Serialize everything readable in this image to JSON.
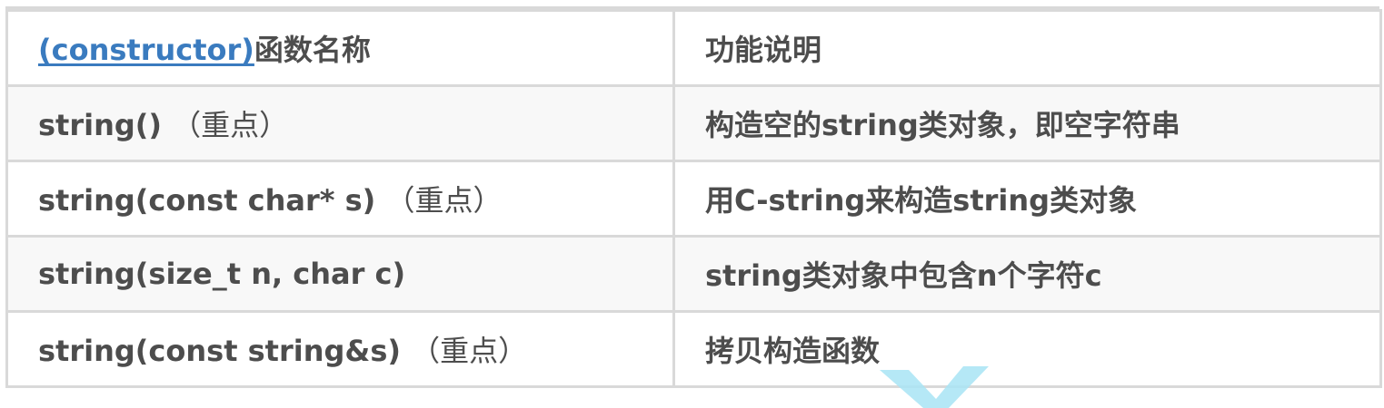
{
  "table": {
    "header": {
      "col1_link": "(constructor)",
      "col1_rest": "函数名称",
      "col2": "功能说明"
    },
    "rows": [
      {
        "signature": "string()",
        "note": "（重点）",
        "description": "构造空的string类对象，即空字符串"
      },
      {
        "signature": "string(const char* s)",
        "note": "（重点）",
        "description": "用C-string来构造string类对象"
      },
      {
        "signature": "string(size_t n, char c)",
        "note": "",
        "description": "string类对象中包含n个字符c"
      },
      {
        "signature": "string(const string&s)",
        "note": "（重点）",
        "description": "拷贝构造函数"
      }
    ]
  },
  "colors": {
    "link": "#3a7bbf",
    "text": "#4d4d4d",
    "border": "#d9d9d9",
    "row_alt": "#f8f8f8",
    "watermark": "#a8e4f5"
  }
}
